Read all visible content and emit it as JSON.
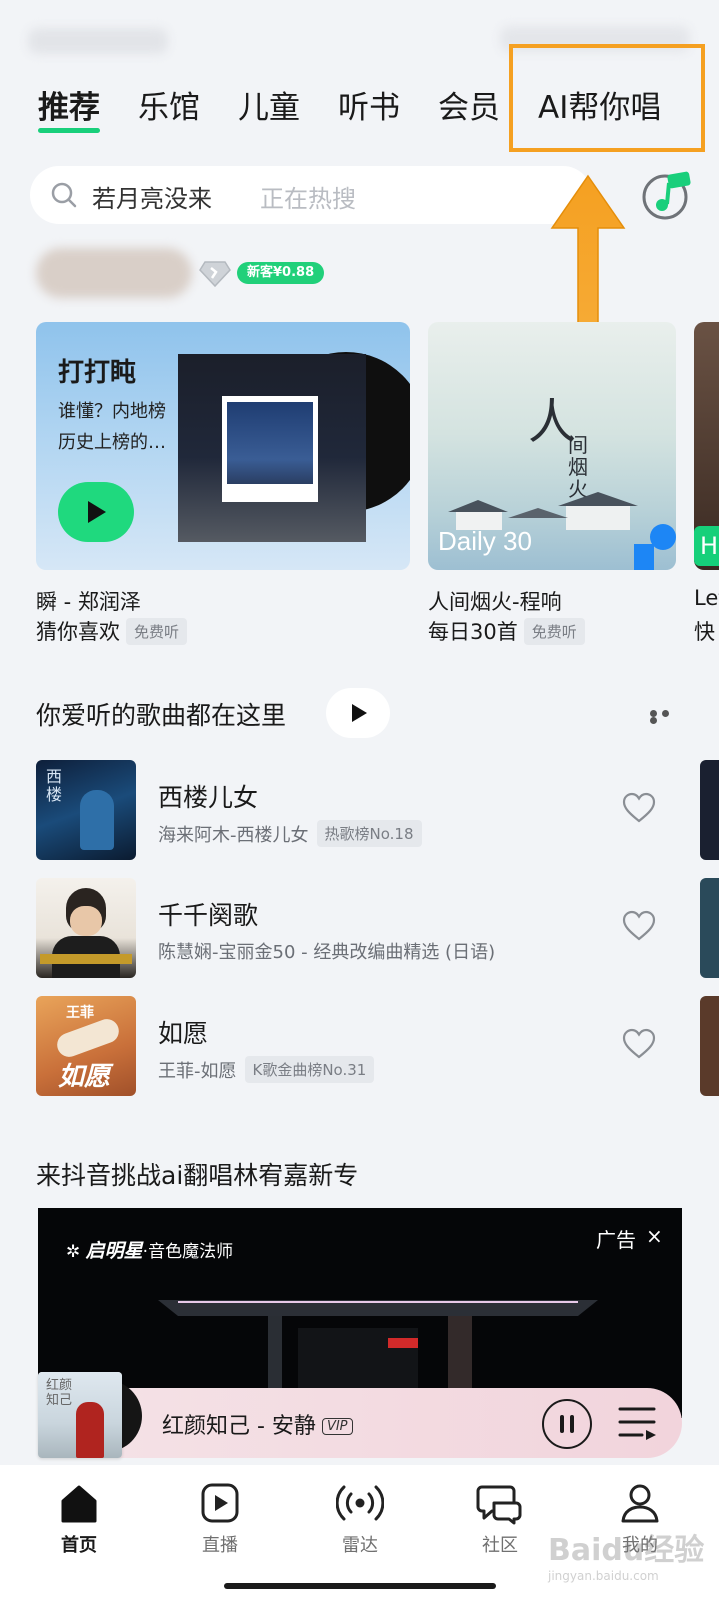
{
  "tabs": [
    {
      "label": "推荐",
      "active": true
    },
    {
      "label": "乐馆",
      "active": false
    },
    {
      "label": "儿童",
      "active": false
    },
    {
      "label": "听书",
      "active": false
    },
    {
      "label": "会员",
      "active": false
    },
    {
      "label": "AI帮你唱",
      "active": false
    }
  ],
  "search": {
    "query": "若月亮没来",
    "hint": "正在热搜"
  },
  "vip": {
    "badge": "新客¥0.88"
  },
  "cards": [
    {
      "title": "打打盹",
      "desc": "谁懂？内地榜历史上榜的…",
      "caption": "瞬 - 郑润泽",
      "subcaption": "猜你喜欢",
      "tag": "免费听"
    },
    {
      "cover_text": "人间烟火",
      "overlay": "Daily 30",
      "caption": "人间烟火-程响",
      "subcaption": "每日30首",
      "tag": "免费听"
    },
    {
      "overlay": "H",
      "caption": "Let",
      "subcaption": "快"
    }
  ],
  "section1": {
    "title": "你爱听的歌曲都在这里"
  },
  "songs": [
    {
      "name": "西楼儿女",
      "sub": "海来阿木-西楼儿女",
      "chart": "热歌榜No.18"
    },
    {
      "name": "千千阕歌",
      "sub": "陈慧娴-宝丽金50 - 经典改编曲精选 (日语)",
      "chart": ""
    },
    {
      "name": "如愿",
      "sub": "王菲-如愿",
      "chart": "K歌金曲榜No.31"
    }
  ],
  "section2": {
    "title": "来抖音挑战ai翻唱林宥嘉新专"
  },
  "ad": {
    "brand": "启明星",
    "tagline": "·音色魔法师",
    "label": "广告",
    "close": "×"
  },
  "player": {
    "art_text": "红颜知己",
    "track": "红颜知己 - 安静",
    "vip": "VIP"
  },
  "nav": [
    {
      "label": "首页",
      "icon": "home-icon",
      "active": true
    },
    {
      "label": "直播",
      "icon": "live-icon",
      "active": false
    },
    {
      "label": "雷达",
      "icon": "radar-icon",
      "active": false
    },
    {
      "label": "社区",
      "icon": "community-icon",
      "active": false
    },
    {
      "label": "我的",
      "icon": "profile-icon",
      "active": false
    }
  ],
  "watermark": {
    "text": "Baidu经验",
    "url": "jingyan.baidu.com"
  },
  "colors": {
    "accent": "#19cf7b",
    "highlight": "#f5a021",
    "background": "#f2f4f7"
  }
}
